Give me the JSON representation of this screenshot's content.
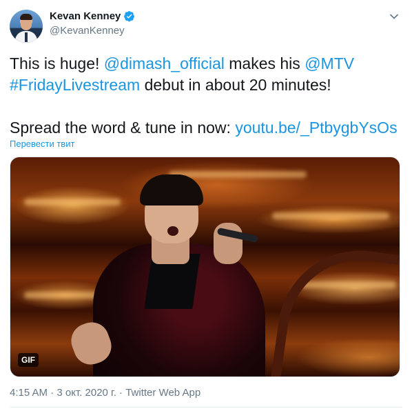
{
  "author": {
    "display_name": "Kevan Kenney",
    "handle": "@KevanKenney",
    "verified": true
  },
  "tweet": {
    "line1_a": "This is huge! ",
    "mention1": "@dimash_official",
    "line1_b": " makes his ",
    "mention2": "@MTV",
    "hashtag": "#FridayLivestream",
    "line2_b": " debut in about 20 minutes!",
    "line3_a": "Spread the word & tune in now: ",
    "link": "youtu.be/_PtbygbYsOs"
  },
  "translate_label": "Перевести твит",
  "media": {
    "badge": "GIF"
  },
  "meta": {
    "time": "4:15 AM",
    "separator1": " · ",
    "date": "3 окт. 2020 г.",
    "separator2": " · ",
    "source": "Twitter Web App"
  },
  "colors": {
    "link": "#1b95e0",
    "text": "#14171a",
    "muted": "#657786",
    "verified": "#1da1f2"
  },
  "icons": {
    "verified": "verified-badge-icon",
    "caret": "chevron-down-icon"
  }
}
